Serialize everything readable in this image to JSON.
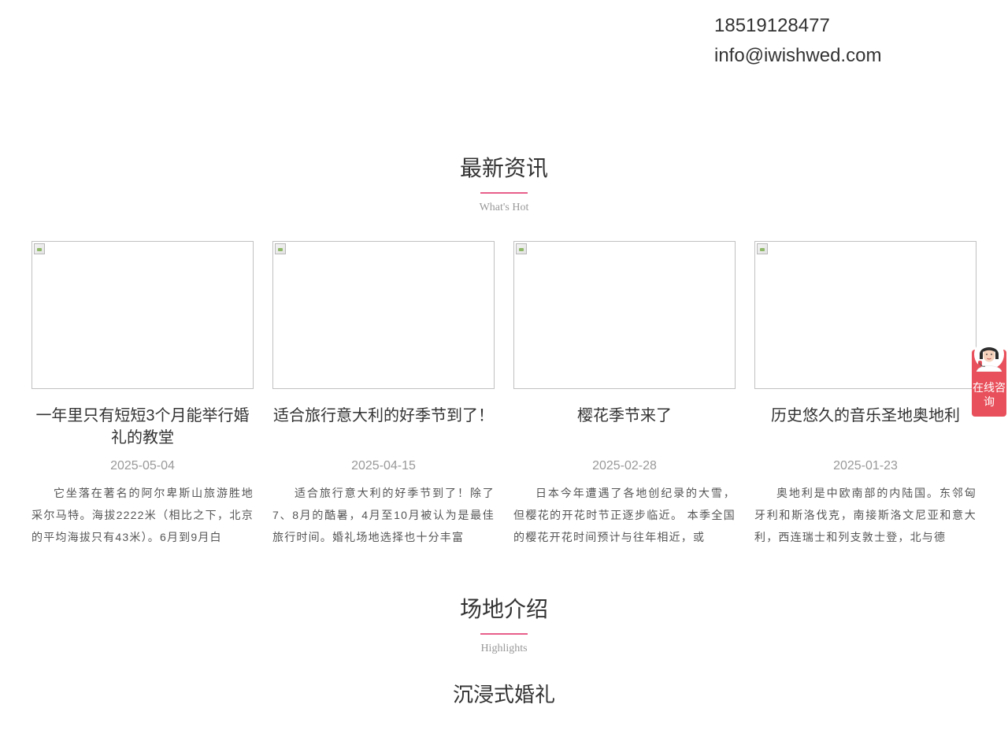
{
  "contact": {
    "phone": "18519128477",
    "email": "info@iwishwed.com"
  },
  "news_section": {
    "title": "最新资讯",
    "subtitle": "What's Hot",
    "items": [
      {
        "title": "一年里只有短短3个月能举行婚礼的教堂",
        "date": "2025-05-04",
        "excerpt": "它坐落在著名的阿尔卑斯山旅游胜地采尔马特。海拔2222米（相比之下，北京的平均海拔只有43米）。6月到9月白"
      },
      {
        "title": "适合旅行意大利的好季节到了！",
        "date": "2025-04-15",
        "excerpt": "适合旅行意大利的好季节到了！除了7、8月的酷暑，4月至10月被认为是最佳旅行时间。婚礼场地选择也十分丰富"
      },
      {
        "title": "樱花季节来了",
        "date": "2025-02-28",
        "excerpt": "日本今年遭遇了各地创纪录的大雪，但樱花的开花时节正逐步临近。 本季全国的樱花开花时间预计与往年相近，或"
      },
      {
        "title": "历史悠久的音乐圣地奥地利",
        "date": "2025-01-23",
        "excerpt": "奥地利是中欧南部的内陆国。东邻匈牙利和斯洛伐克，南接斯洛文尼亚和意大利，西连瑞士和列支敦士登，北与德"
      }
    ]
  },
  "venue_section": {
    "title": "场地介绍",
    "subtitle": "Highlights",
    "feature_title": "沉浸式婚礼"
  },
  "chat_widget": {
    "label": "在线咨询",
    "icon": "customer-service-avatar-icon"
  },
  "colors": {
    "accent": "#e8608a",
    "chat": "#e8505b",
    "text": "#333333",
    "muted": "#999999"
  }
}
